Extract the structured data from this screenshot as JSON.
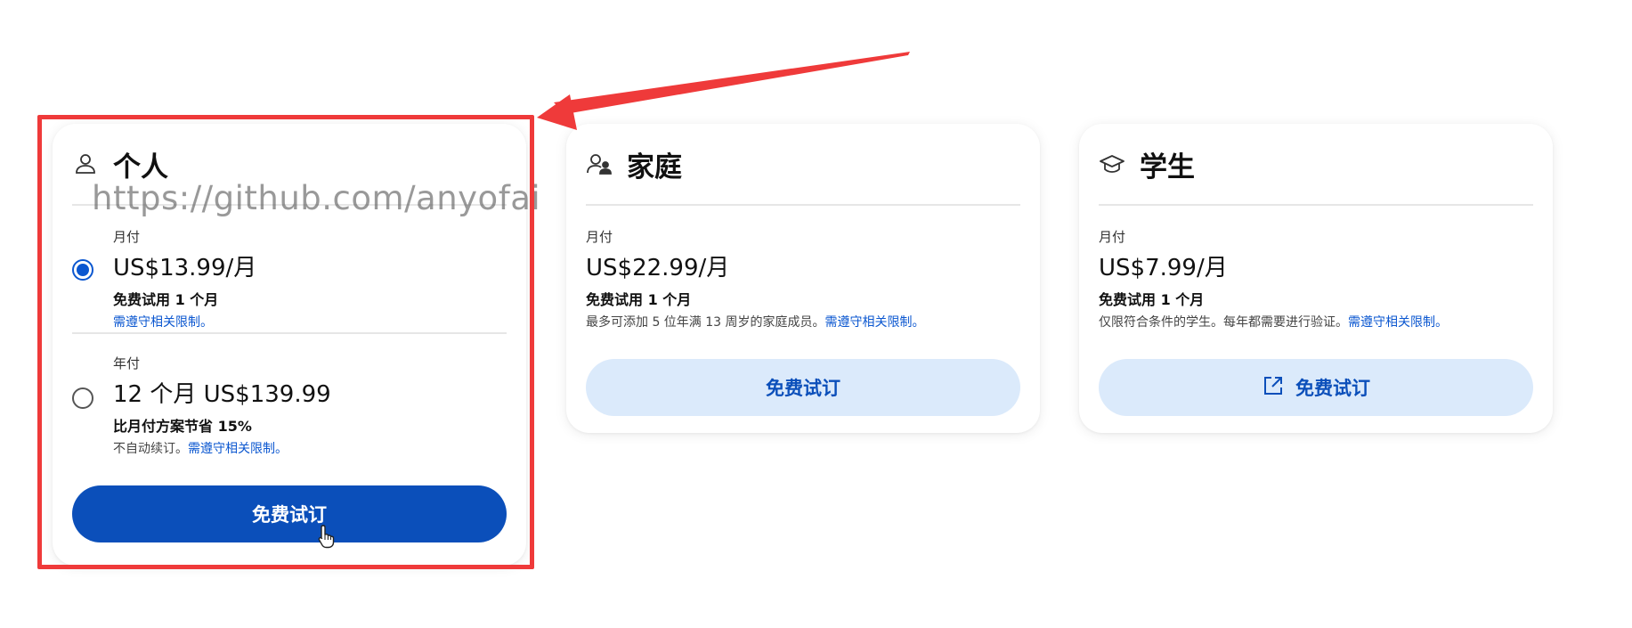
{
  "watermark_text": "https://github.com/anyofai",
  "plans": [
    {
      "title": "个人",
      "icon": "person-icon",
      "options": [
        {
          "period": "月付",
          "price": "US$13.99/月",
          "trial": "免费试用 1 个月",
          "note_text": "",
          "note_link": "需遵守相关限制。",
          "selected": true
        },
        {
          "period": "年付",
          "price": "12 个月 US$139.99",
          "trial": "比月付方案节省 15%",
          "note_text": "不自动续订。",
          "note_link": "需遵守相关限制。",
          "selected": false
        }
      ],
      "button_label": "免费试订"
    },
    {
      "title": "家庭",
      "icon": "family-icon",
      "period": "月付",
      "price": "US$22.99/月",
      "trial": "免费试用 1 个月",
      "note_text": "最多可添加 5 位年满 13 周岁的家庭成员。",
      "note_link": "需遵守相关限制。",
      "button_label": "免费试订"
    },
    {
      "title": "学生",
      "icon": "graduation-cap-icon",
      "period": "月付",
      "price": "US$7.99/月",
      "trial": "免费试用 1 个月",
      "note_text": "仅限符合条件的学生。每年都需要进行验证。",
      "note_link": "需遵守相关限制。",
      "button_label": "免费试订",
      "button_icon": "external-link-icon"
    }
  ],
  "colors": {
    "primary": "#0b4fba",
    "link": "#0b57d0",
    "secondary_button_bg": "#dbeafb",
    "annotation_red": "#ef3a3a"
  }
}
